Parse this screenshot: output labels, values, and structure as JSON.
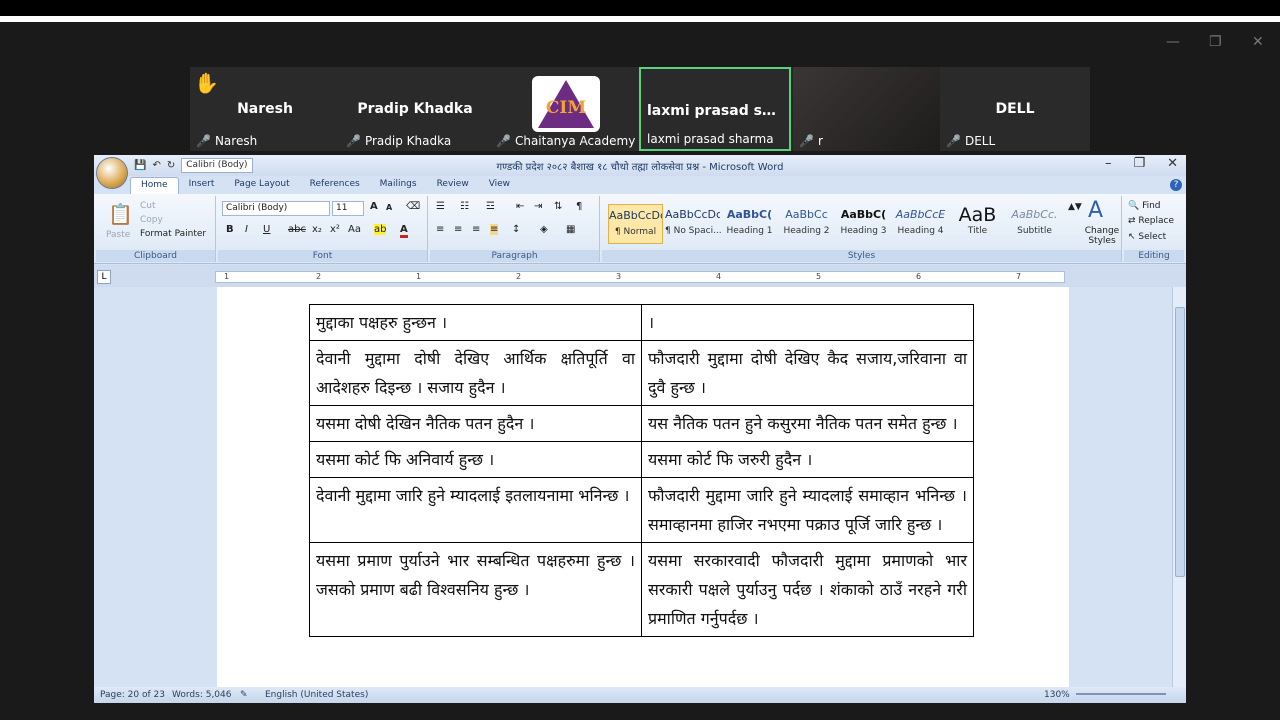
{
  "meeting": {
    "participants": [
      {
        "tile_name": "Naresh",
        "label": "Naresh"
      },
      {
        "tile_name": "Pradip Khadka",
        "label": "Pradip Khadka"
      },
      {
        "tile_name": "",
        "label": "Chaitanya Academy",
        "logo_text": "CIM"
      },
      {
        "tile_name": "laxmi prasad sh...",
        "label": "laxmi prasad sharma"
      },
      {
        "tile_name": "",
        "label": "r"
      },
      {
        "tile_name": "DELL",
        "label": "DELL"
      }
    ],
    "hand_icon": "raised-hand-icon",
    "mic_icon": "mic-muted-icon",
    "active_color": "#58d27b"
  },
  "word": {
    "title": "गण्डकी प्रदेश २०८२ बैशाख १८ चौथो तह्मा लोकसेवा प्रश्न - Microsoft Word",
    "qat_font": "Calibri (Body)",
    "tabs": [
      "Home",
      "Insert",
      "Page Layout",
      "References",
      "Mailings",
      "Review",
      "View"
    ],
    "clipboard": {
      "paste": "Paste",
      "cut": "Cut",
      "copy": "Copy",
      "format_painter": "Format Painter",
      "label": "Clipboard"
    },
    "font": {
      "name": "Calibri (Body)",
      "size": "11",
      "label": "Font"
    },
    "paragraph": {
      "label": "Paragraph"
    },
    "styles": {
      "label": "Styles",
      "items": [
        {
          "preview": "AaBbCcDc",
          "name": "¶ Normal"
        },
        {
          "preview": "AaBbCcDc",
          "name": "¶ No Spaci..."
        },
        {
          "preview": "AaBbC(",
          "name": "Heading 1"
        },
        {
          "preview": "AaBbCc",
          "name": "Heading 2"
        },
        {
          "preview": "AaBbC(",
          "name": "Heading 3"
        },
        {
          "preview": "AaBbCcE",
          "name": "Heading 4"
        },
        {
          "preview": "AaB",
          "name": "Title"
        },
        {
          "preview": "AaBbCc.",
          "name": "Subtitle"
        }
      ],
      "change": "Change Styles"
    },
    "editing": {
      "find": "Find",
      "replace": "Replace",
      "select": "Select",
      "label": "Editing"
    },
    "ruler_numbers": [
      "1",
      "2",
      "1",
      "2",
      "3",
      "4",
      "5",
      "6",
      "7"
    ],
    "table": [
      [
        "मुद्दाका पक्षहरु हुन्छन ।",
        "।"
      ],
      [
        "देवानी मुद्दामा दोषी देखिए आर्थिक क्षतिपूर्ति वा आदेशहरु दिइन्छ । सजाय हुदैन ।",
        "फौजदारी मुद्दामा दोषी देखिए कैद सजाय,जरिवाना वा दुवै हुन्छ ।"
      ],
      [
        "यसमा दोषी देखिन नैतिक पतन हुदैन ।",
        "यस नैतिक पतन हुने कसुरमा नैतिक पतन समेत हुन्छ ।"
      ],
      [
        "यसमा कोर्ट फि अनिवार्य हुन्छ ।",
        "यसमा कोर्ट फि जरुरी हुदैन ।"
      ],
      [
        "देवानी मुद्दामा जारि हुने म्यादलाई इतलायनामा भनिन्छ ।",
        "फौजदारी मुद्दामा जारि हुने म्यादलाई समाव्हान भनिन्छ । समाव्हानमा हाजिर नभएमा पक्राउ पूर्जि जारि हुन्छ ।"
      ],
      [
        "यसमा प्रमाण पुर्याउने भार सम्बन्धित पक्षहरुमा हुन्छ । जसको प्रमाण बढी विश्वसनिय हुन्छ ।",
        "यसमा सरकारवादी फौजदारी मुद्दामा प्रमाणको भार सरकारी पक्षले पुर्याउनु पर्दछ । शंकाको ठाउँ नरहने गरी प्रमाणित गर्नुपर्दछ ।"
      ]
    ],
    "status": {
      "page": "Page: 20 of 23",
      "words": "Words: 5,046",
      "language": "English (United States)",
      "zoom": "130%"
    }
  }
}
